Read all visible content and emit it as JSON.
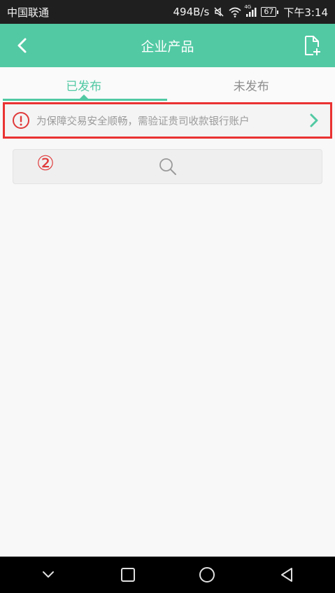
{
  "status_bar": {
    "carrier": "中国联通",
    "speed": "494B/s",
    "network": "4G",
    "battery": "67",
    "time": "下午3:14"
  },
  "app_bar": {
    "title": "企业产品",
    "back_icon": "chevron-left-icon",
    "add_icon": "add-document-icon"
  },
  "tabs": [
    {
      "label": "已发布",
      "active": true
    },
    {
      "label": "未发布",
      "active": false
    }
  ],
  "notice": {
    "text": "为保障交易安全顺畅，需验证贵司收款银行账户",
    "icon": "warning-icon",
    "arrow_icon": "chevron-right-icon"
  },
  "annotation": {
    "label": "②"
  },
  "search": {
    "icon": "search-icon"
  },
  "nav_bar": {
    "items": [
      "chevron-down-icon",
      "square-icon",
      "circle-icon",
      "triangle-back-icon"
    ]
  },
  "colors": {
    "accent": "#52c9a3",
    "highlight": "#ea3232",
    "status_bar": "#1f1f1f",
    "background": "#f8f8f8"
  }
}
